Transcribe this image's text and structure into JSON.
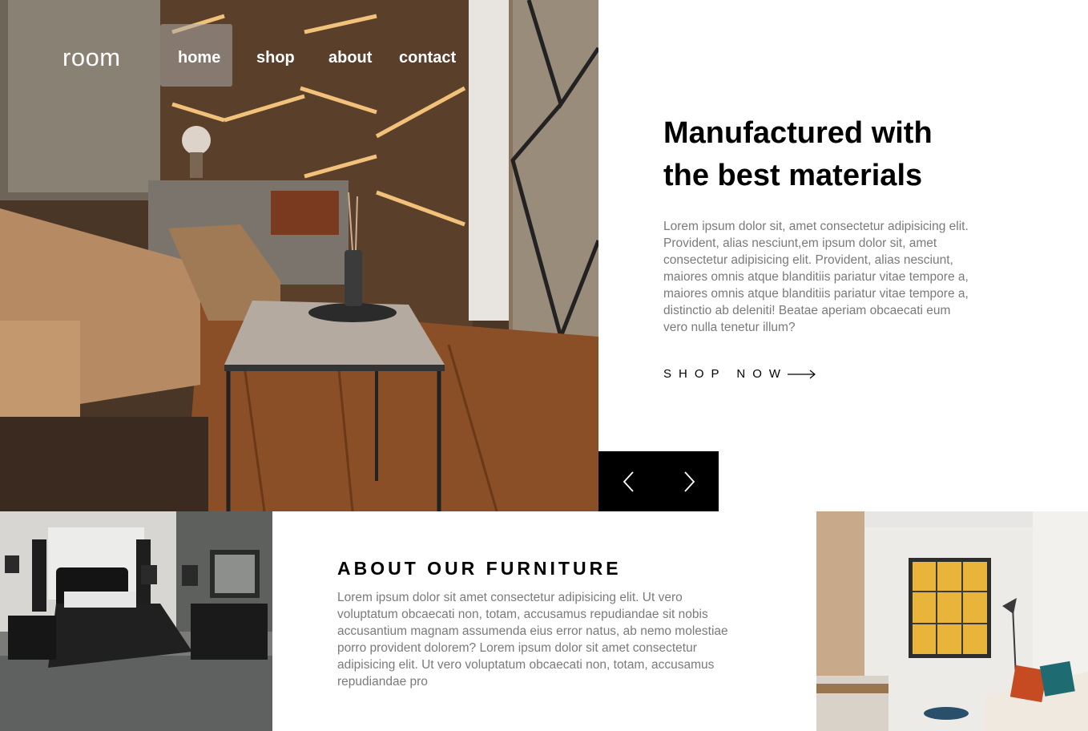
{
  "header": {
    "logo": "room",
    "nav": [
      {
        "label": "home"
      },
      {
        "label": "shop"
      },
      {
        "label": "about"
      },
      {
        "label": "contact"
      }
    ]
  },
  "hero": {
    "headline_line1": "Manufactured with",
    "headline_line2": "the best materials",
    "description": "Lorem ipsum dolor sit, amet consectetur adipisicing elit. Provident, alias nesciunt,em ipsum dolor sit, amet consectetur adipisicing elit. Provident, alias nesciunt, maiores omnis atque blanditiis pariatur vitae tempore a, maiores omnis atque blanditiis pariatur vitae tempore a, distinctio ab deleniti! Beatae aperiam obcaecati eum vero nulla tenetur illum?",
    "cta_label": "SHOP NOW",
    "prev_icon": "chevron-left-icon",
    "next_icon": "chevron-right-icon"
  },
  "about": {
    "title": "ABOUT OUR FURNITURE",
    "text": "Lorem ipsum dolor sit amet consectetur adipisicing elit. Ut vero voluptatum obcaecati non, totam, accusamus repudiandae sit nobis accusantium magnam assumenda eius error natus, ab nemo molestiae porro provident dolorem? Lorem ipsum dolor sit amet consectetur adipisicing elit. Ut vero voluptatum obcaecati non, totam, accusamus repudiandae pro"
  },
  "colors": {
    "text": "#000000",
    "muted": "#7a7a7a",
    "control_bg": "#000000"
  }
}
